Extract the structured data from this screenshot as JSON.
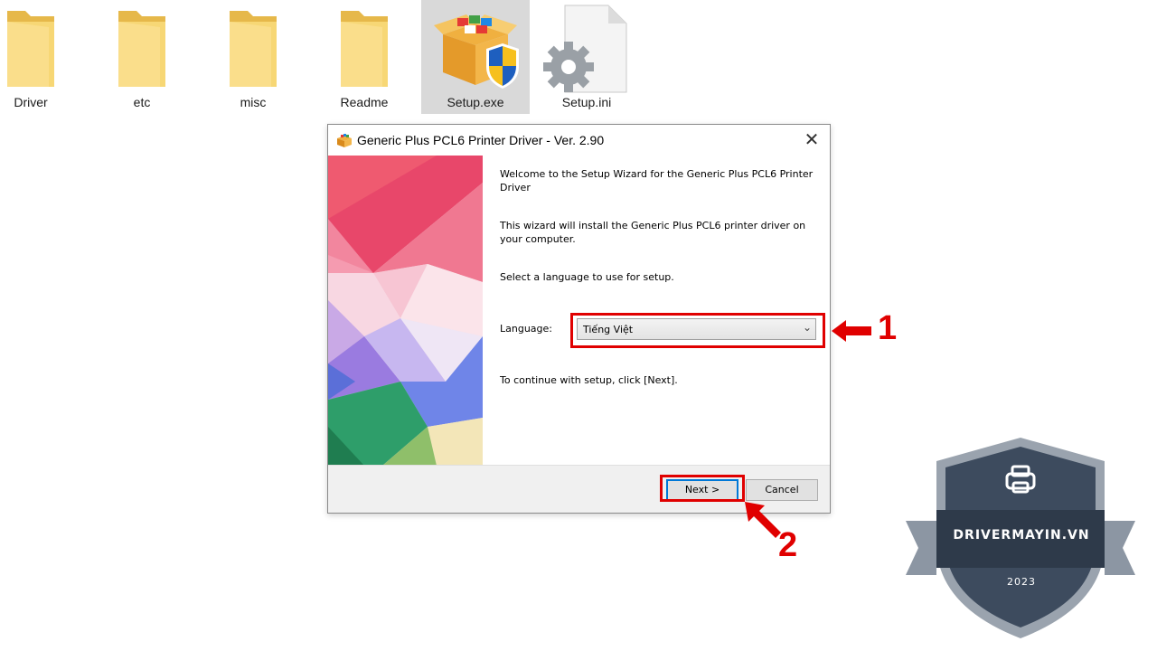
{
  "explorer": {
    "files": [
      {
        "label": "Driver",
        "icon": "folder-icon"
      },
      {
        "label": "etc",
        "icon": "folder-icon"
      },
      {
        "label": "misc",
        "icon": "folder-icon"
      },
      {
        "label": "Readme",
        "icon": "folder-icon"
      },
      {
        "label": "Setup.exe",
        "icon": "setup-package-icon",
        "selected": true
      },
      {
        "label": "Setup.ini",
        "icon": "settings-file-icon"
      }
    ]
  },
  "dialog": {
    "title": "Generic Plus PCL6 Printer Driver - Ver. 2.90",
    "close_glyph": "✕",
    "welcome": "Welcome to the Setup Wizard for the Generic Plus PCL6 Printer Driver",
    "description": "This wizard will install the Generic Plus PCL6 printer driver on your computer.",
    "select_prompt": "Select a language to use for setup.",
    "language_label": "Language:",
    "language_value": "Tiếng Việt",
    "continue_text": "To continue with setup, click [Next].",
    "next_label": "Next >",
    "cancel_label": "Cancel"
  },
  "annotations": {
    "step1": "1",
    "step2": "2",
    "color": "#e00000"
  },
  "watermark": {
    "brand": "DRIVERMAYIN.VN",
    "year": "2023",
    "icon": "printer-icon"
  }
}
